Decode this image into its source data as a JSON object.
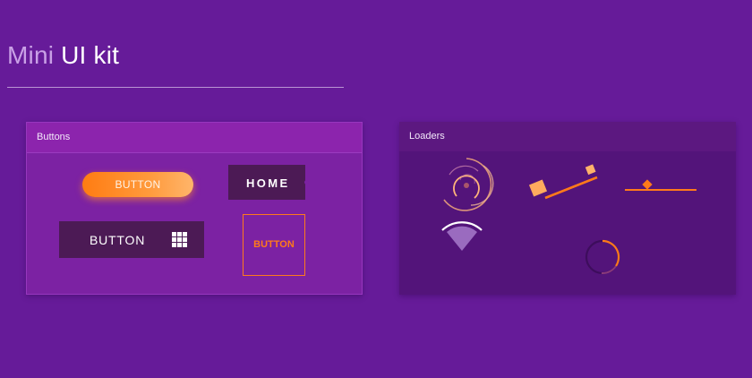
{
  "page": {
    "title_light": "Mini ",
    "title_bold": "UI kit"
  },
  "panels": {
    "buttons": {
      "header": "Buttons",
      "pill_label": "BUTTON",
      "home_label": "HOME",
      "grid_label": "BUTTON",
      "outline_label": "BUTTON"
    },
    "loaders": {
      "header": "Loaders"
    }
  },
  "colors": {
    "background": "#661b99",
    "accent_orange": "#ff7a1a",
    "dark_button": "#4c1a55",
    "buttons_panel": "#7c22a3",
    "loaders_panel": "#53147a"
  },
  "icons": {
    "grid_button_icon": "grid-icon",
    "home_indicator": "dot-icon"
  }
}
